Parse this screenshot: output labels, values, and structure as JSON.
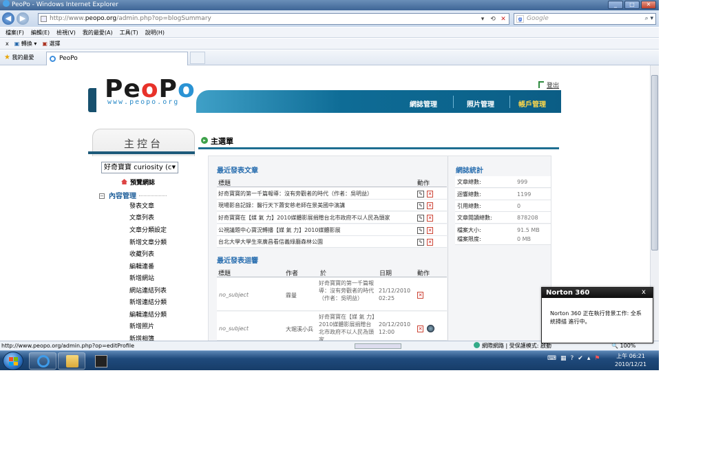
{
  "window": {
    "title": "PeoPo - Windows Internet Explorer"
  },
  "address": {
    "prefix": "http://www.",
    "host": "peopo.org",
    "rest": "/admin.php?op=blogSummary"
  },
  "search": {
    "placeholder": "Google"
  },
  "menubar": [
    "檔案(F)",
    "編輯(E)",
    "檢視(V)",
    "我的最愛(A)",
    "工具(T)",
    "說明(H)"
  ],
  "linksbar": {
    "close": "x",
    "convert": "轉換",
    "select": "選擇"
  },
  "favorites": {
    "label": "我的最愛"
  },
  "tab": {
    "label": "PeoPo"
  },
  "logo": {
    "url": "www.peopo.org"
  },
  "header": {
    "logout": "登出"
  },
  "nav": [
    {
      "label": "網誌管理"
    },
    {
      "label": "照片管理"
    },
    {
      "label": "帳戶管理"
    }
  ],
  "sidebar": {
    "title": "主控台",
    "blog_select": "好奇寶寶 curiosity (c",
    "preview": "預覽網誌",
    "section": "內容管理",
    "items": [
      "發表文章",
      "文章列表",
      "文章分類設定",
      "新增文章分類",
      "收藏列表",
      "編輯連番",
      "新增網站",
      "網站連結列表",
      "新增連結分類",
      "編輯連結分類",
      "新增照片",
      "新增相簿"
    ]
  },
  "main": {
    "title": "主選單",
    "recent_posts": {
      "title": "最近發表文章",
      "col_title": "標題",
      "col_action": "動作",
      "rows": [
        "好奇寶寶的第一千篇報導：沒有旁觀者的時代（作者：吳明益）",
        "現場影音記錄：醫行天下蕭安慈老師在景美國中演講",
        "好奇寶寶在【媒 氣 力】2010媒體影展捐贈台北市政府不以人民為頭家",
        "公視議題中心寶況轉播【媒 氣 力】2010媒體影展",
        "台北大學大學生來廣昌看信義綠廳森林公園"
      ]
    },
    "recent_comments": {
      "title": "最近發表迴響",
      "col_title": "標題",
      "col_author": "作者",
      "col_about": "於",
      "col_date": "日期",
      "col_action": "動作",
      "rows": [
        {
          "subject": "no_subject",
          "author": "霖曼",
          "about": "好奇寶寶的第一千篇報導：沒有旁觀者的時代（作者：吳明益）",
          "date": "21/12/2010 02:25"
        },
        {
          "subject": "no_subject",
          "author": "大堀溪小兵",
          "about": "好奇寶寶在【媒 氣 力】2010媒體影展捐贈台北市政府不以人民為頭家",
          "date": "20/12/2010 12:00"
        }
      ]
    },
    "stats": {
      "title": "網誌統計",
      "rows": [
        {
          "label": "文章總數:",
          "value": "999"
        },
        {
          "label": "迴響總數:",
          "value": "1199"
        },
        {
          "label": "引用總數:",
          "value": "0"
        },
        {
          "label": "文章閱讀總數:",
          "value": "878208"
        },
        {
          "label": "檔案大小:",
          "value": "91.5 MB"
        },
        {
          "label": "檔案限度:",
          "value": "0 MB"
        }
      ]
    }
  },
  "statusbar": {
    "url": "http://www.peopo.org/admin.php?op=editProfile",
    "zone": "網際網路 | 受保護模式: 啟動",
    "zoom": "100%"
  },
  "taskbar": {
    "time": "上午 06:21",
    "date": "2010/12/21"
  },
  "norton": {
    "title": "Norton 360",
    "close": "x",
    "message": "Norton 360 正在執行背景工作: 全系統掃描 進行中。"
  }
}
